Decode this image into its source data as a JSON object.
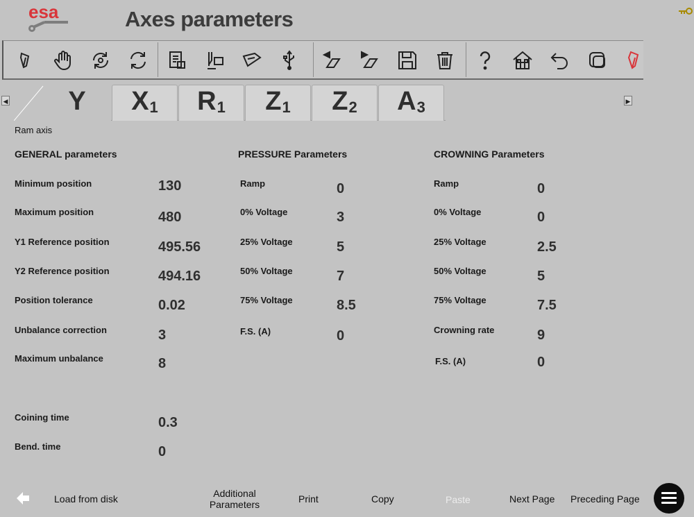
{
  "brand": {
    "name": "esa",
    "color": "#d9353a"
  },
  "header": {
    "title": "Axes parameters"
  },
  "toolbar": {
    "icons": [
      "pointer-icon",
      "hand-icon",
      "refresh-icon",
      "rotate-icon",
      "document-list-icon",
      "machine-load-icon",
      "press-brake-icon",
      "usb-icon",
      "back-gauge-left-icon",
      "back-gauge-right-icon",
      "save-icon",
      "delete-icon",
      "help-icon",
      "home-icon",
      "undo-icon",
      "copy-window-icon",
      "pen-icon"
    ]
  },
  "tabs": [
    {
      "main": "Y",
      "sub": ""
    },
    {
      "main": "X",
      "sub": "1"
    },
    {
      "main": "R",
      "sub": "1"
    },
    {
      "main": "Z",
      "sub": "1"
    },
    {
      "main": "Z",
      "sub": "2"
    },
    {
      "main": "A",
      "sub": "3"
    }
  ],
  "section": "Ram axis",
  "general": {
    "title": "GENERAL parameters",
    "params": [
      {
        "label": "Minimum position",
        "value": "130"
      },
      {
        "label": "Maximum position",
        "value": "480"
      },
      {
        "label": "Y1 Reference position",
        "value": "495.56"
      },
      {
        "label": "Y2 Reference position",
        "value": "494.16"
      },
      {
        "label": "Position tolerance",
        "value": "0.02"
      },
      {
        "label": "Unbalance correction",
        "value": "3"
      },
      {
        "label": "Maximum unbalance",
        "value": "8"
      },
      {
        "label": "Coining time",
        "value": "0.3"
      },
      {
        "label": "Bend. time",
        "value": "0"
      }
    ]
  },
  "pressure": {
    "title": "PRESSURE Parameters",
    "params": [
      {
        "label": "Ramp",
        "value": "0"
      },
      {
        "label": "0% Voltage",
        "value": "3"
      },
      {
        "label": "25% Voltage",
        "value": "5"
      },
      {
        "label": "50% Voltage",
        "value": "7"
      },
      {
        "label": "75% Voltage",
        "value": "8.5"
      },
      {
        "label": "F.S. (A)",
        "value": "0"
      }
    ]
  },
  "crowning": {
    "title": "CROWNING Parameters",
    "params": [
      {
        "label": "Ramp",
        "value": "0"
      },
      {
        "label": "0% Voltage",
        "value": "0"
      },
      {
        "label": "25% Voltage",
        "value": "2.5"
      },
      {
        "label": "50% Voltage",
        "value": "5"
      },
      {
        "label": "75% Voltage",
        "value": "7.5"
      },
      {
        "label": "Crowning rate",
        "value": "9"
      },
      {
        "label": "F.S. (A)",
        "value": "0"
      }
    ]
  },
  "bottom": {
    "load": "Load from disk",
    "additional_1": "Additional",
    "additional_2": "Parameters",
    "print": "Print",
    "copy": "Copy",
    "paste": "Paste",
    "next": "Next Page",
    "preceding": "Preceding Page"
  },
  "colors": {
    "background": "#c3c3c3",
    "accent": "#d9353a"
  }
}
